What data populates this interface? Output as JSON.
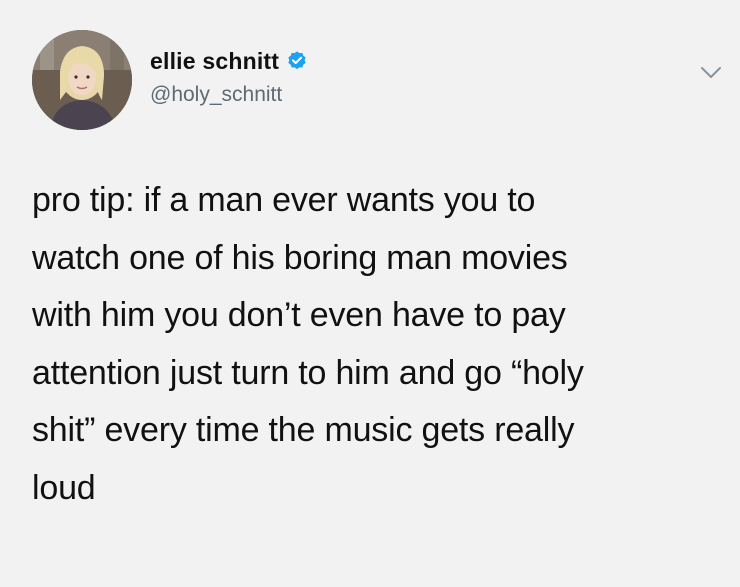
{
  "tweet": {
    "author": {
      "display_name": "ellie schnitt",
      "handle": "@holy_schnitt",
      "verified": true,
      "verified_color": "#1da1f2"
    },
    "avatar_icon": "profile-photo",
    "menu_icon": "chevron-down-icon",
    "text": "pro tip: if a man ever wants you to\nwatch one of his boring man movies\nwith him you don’t even have to pay\nattention just turn to him and go “holy\nshit” every time the music gets really\nloud"
  },
  "colors": {
    "background": "#f2f2f2",
    "text": "#111111",
    "handle": "#5f6a73",
    "verified_badge": "#1da1f2"
  }
}
